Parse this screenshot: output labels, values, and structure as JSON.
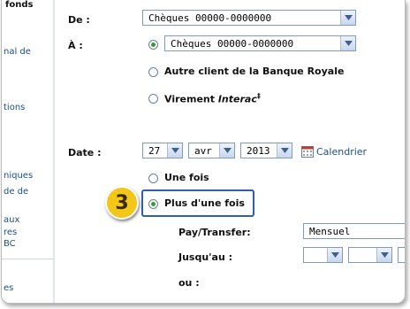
{
  "sidebar": {
    "heading": "fonds",
    "items": [
      {
        "label": "nal de"
      },
      {
        "label": "tions"
      },
      {
        "label": "niques"
      },
      {
        "label": "de de"
      },
      {
        "label": "aux"
      },
      {
        "label": "res"
      },
      {
        "label": "BC"
      },
      {
        "label": "es"
      }
    ]
  },
  "form": {
    "from_label": "De :",
    "from_value": "Chèques 00000-0000000",
    "to_label": "À :",
    "to_options": [
      {
        "label": "Chèques 00000-0000000",
        "selected": true
      },
      {
        "label": "Autre client de la Banque Royale",
        "selected": false
      },
      {
        "label": "Virement ",
        "label_italic": "Interac",
        "mark": "‡",
        "selected": false
      }
    ],
    "date_label": "Date :",
    "date_day": "27",
    "date_month": "avr",
    "date_year": "2013",
    "calendar_label": "Calendrier",
    "frequency_options": [
      {
        "label": "Une fois",
        "selected": false
      },
      {
        "label": "Plus d'une fois",
        "selected": true
      }
    ],
    "paytransfer_label": "Pay/Transfer:",
    "paytransfer_value": "Mensuel",
    "until_label": "Jusqu'au :",
    "or_label": "ou :"
  },
  "callout": {
    "number": "3"
  },
  "colors": {
    "accent": "#2f5db1",
    "badge": "#f3c61a",
    "radio_on": "#2f9e35",
    "link": "#1a4f8b"
  }
}
